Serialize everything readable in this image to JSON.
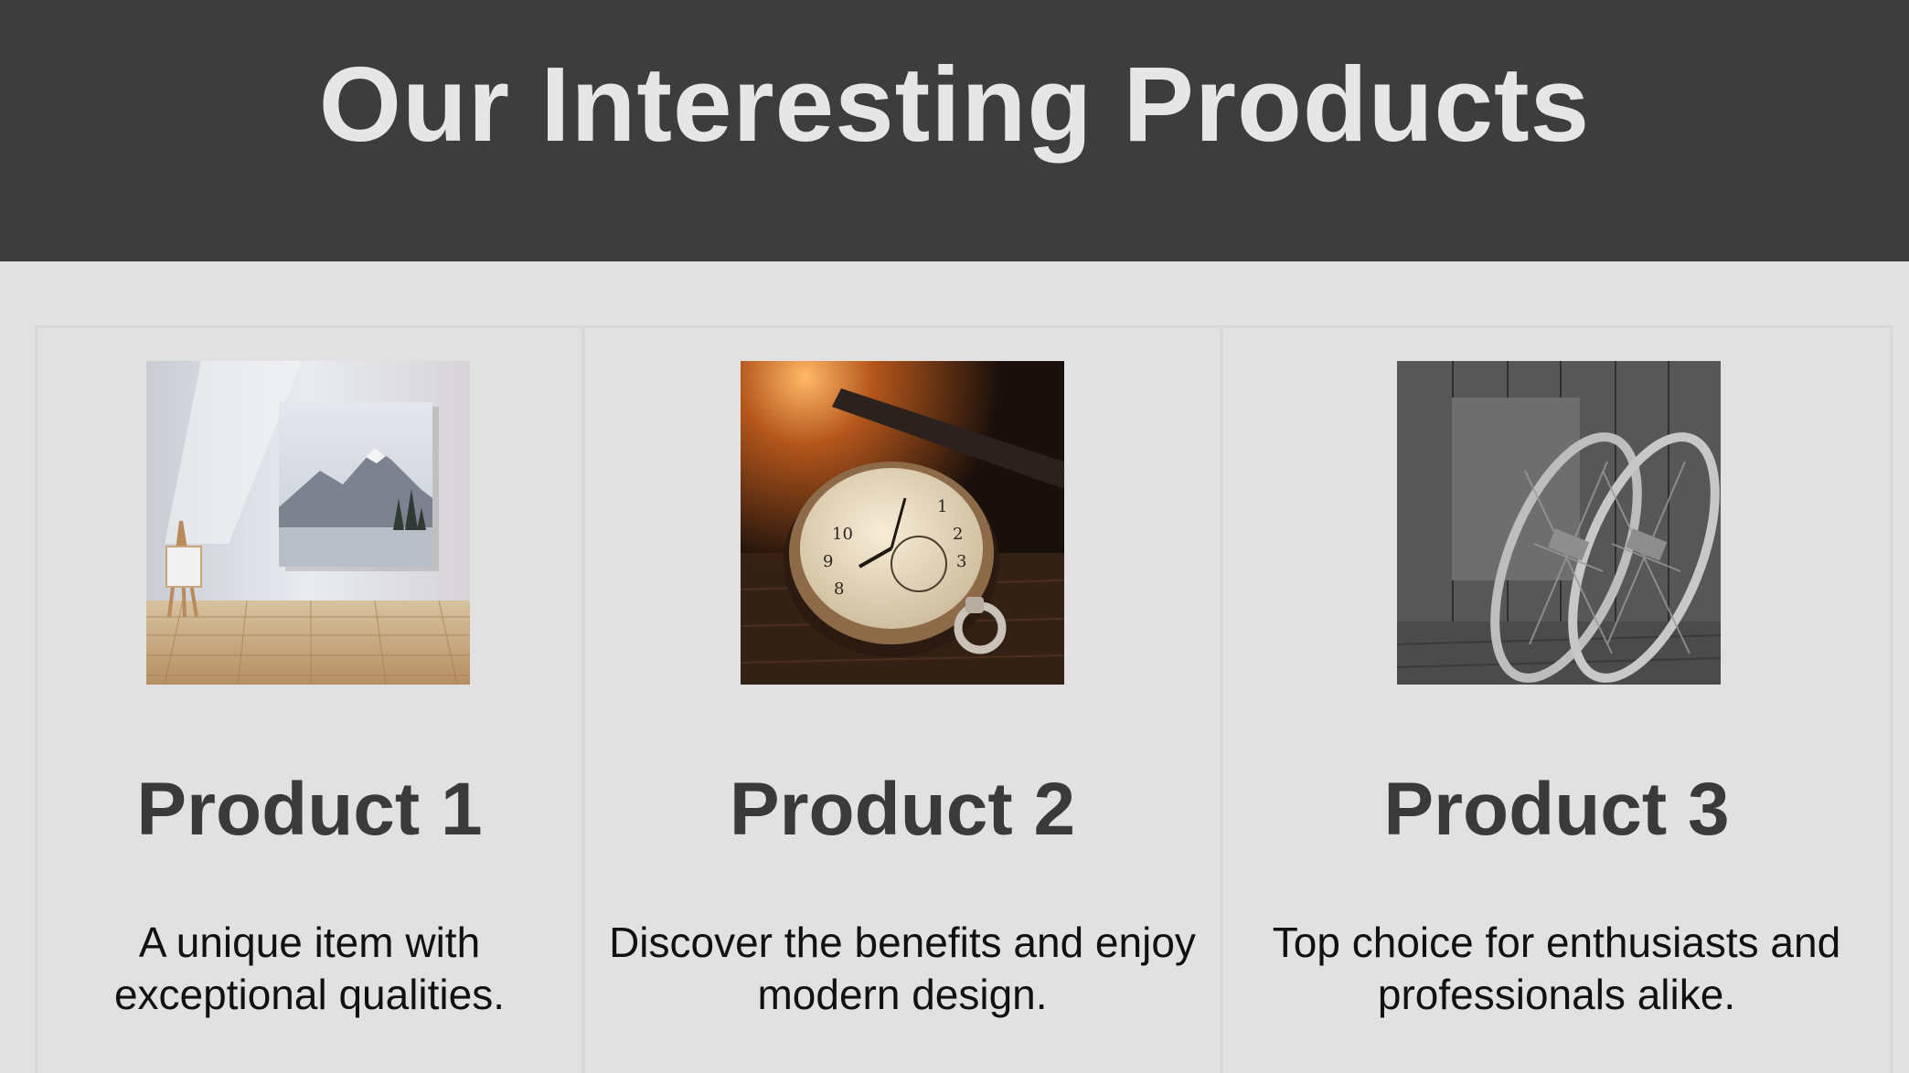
{
  "header": {
    "title": "Our Interesting Products"
  },
  "products": [
    {
      "title": "Product 1",
      "description": "A unique item with exceptional qualities.",
      "image": "mountain-painting-image"
    },
    {
      "title": "Product 2",
      "description": "Discover the benefits and enjoy modern design.",
      "image": "pocket-watch-image"
    },
    {
      "title": "Product 3",
      "description": "Top choice for enthusiasts and professionals alike.",
      "image": "snowshoes-image"
    }
  ],
  "colors": {
    "header_bg": "#3d3d3d",
    "header_text": "#e6e6e6",
    "page_bg": "#e1e1e1",
    "title_text": "#3a3a3a"
  }
}
